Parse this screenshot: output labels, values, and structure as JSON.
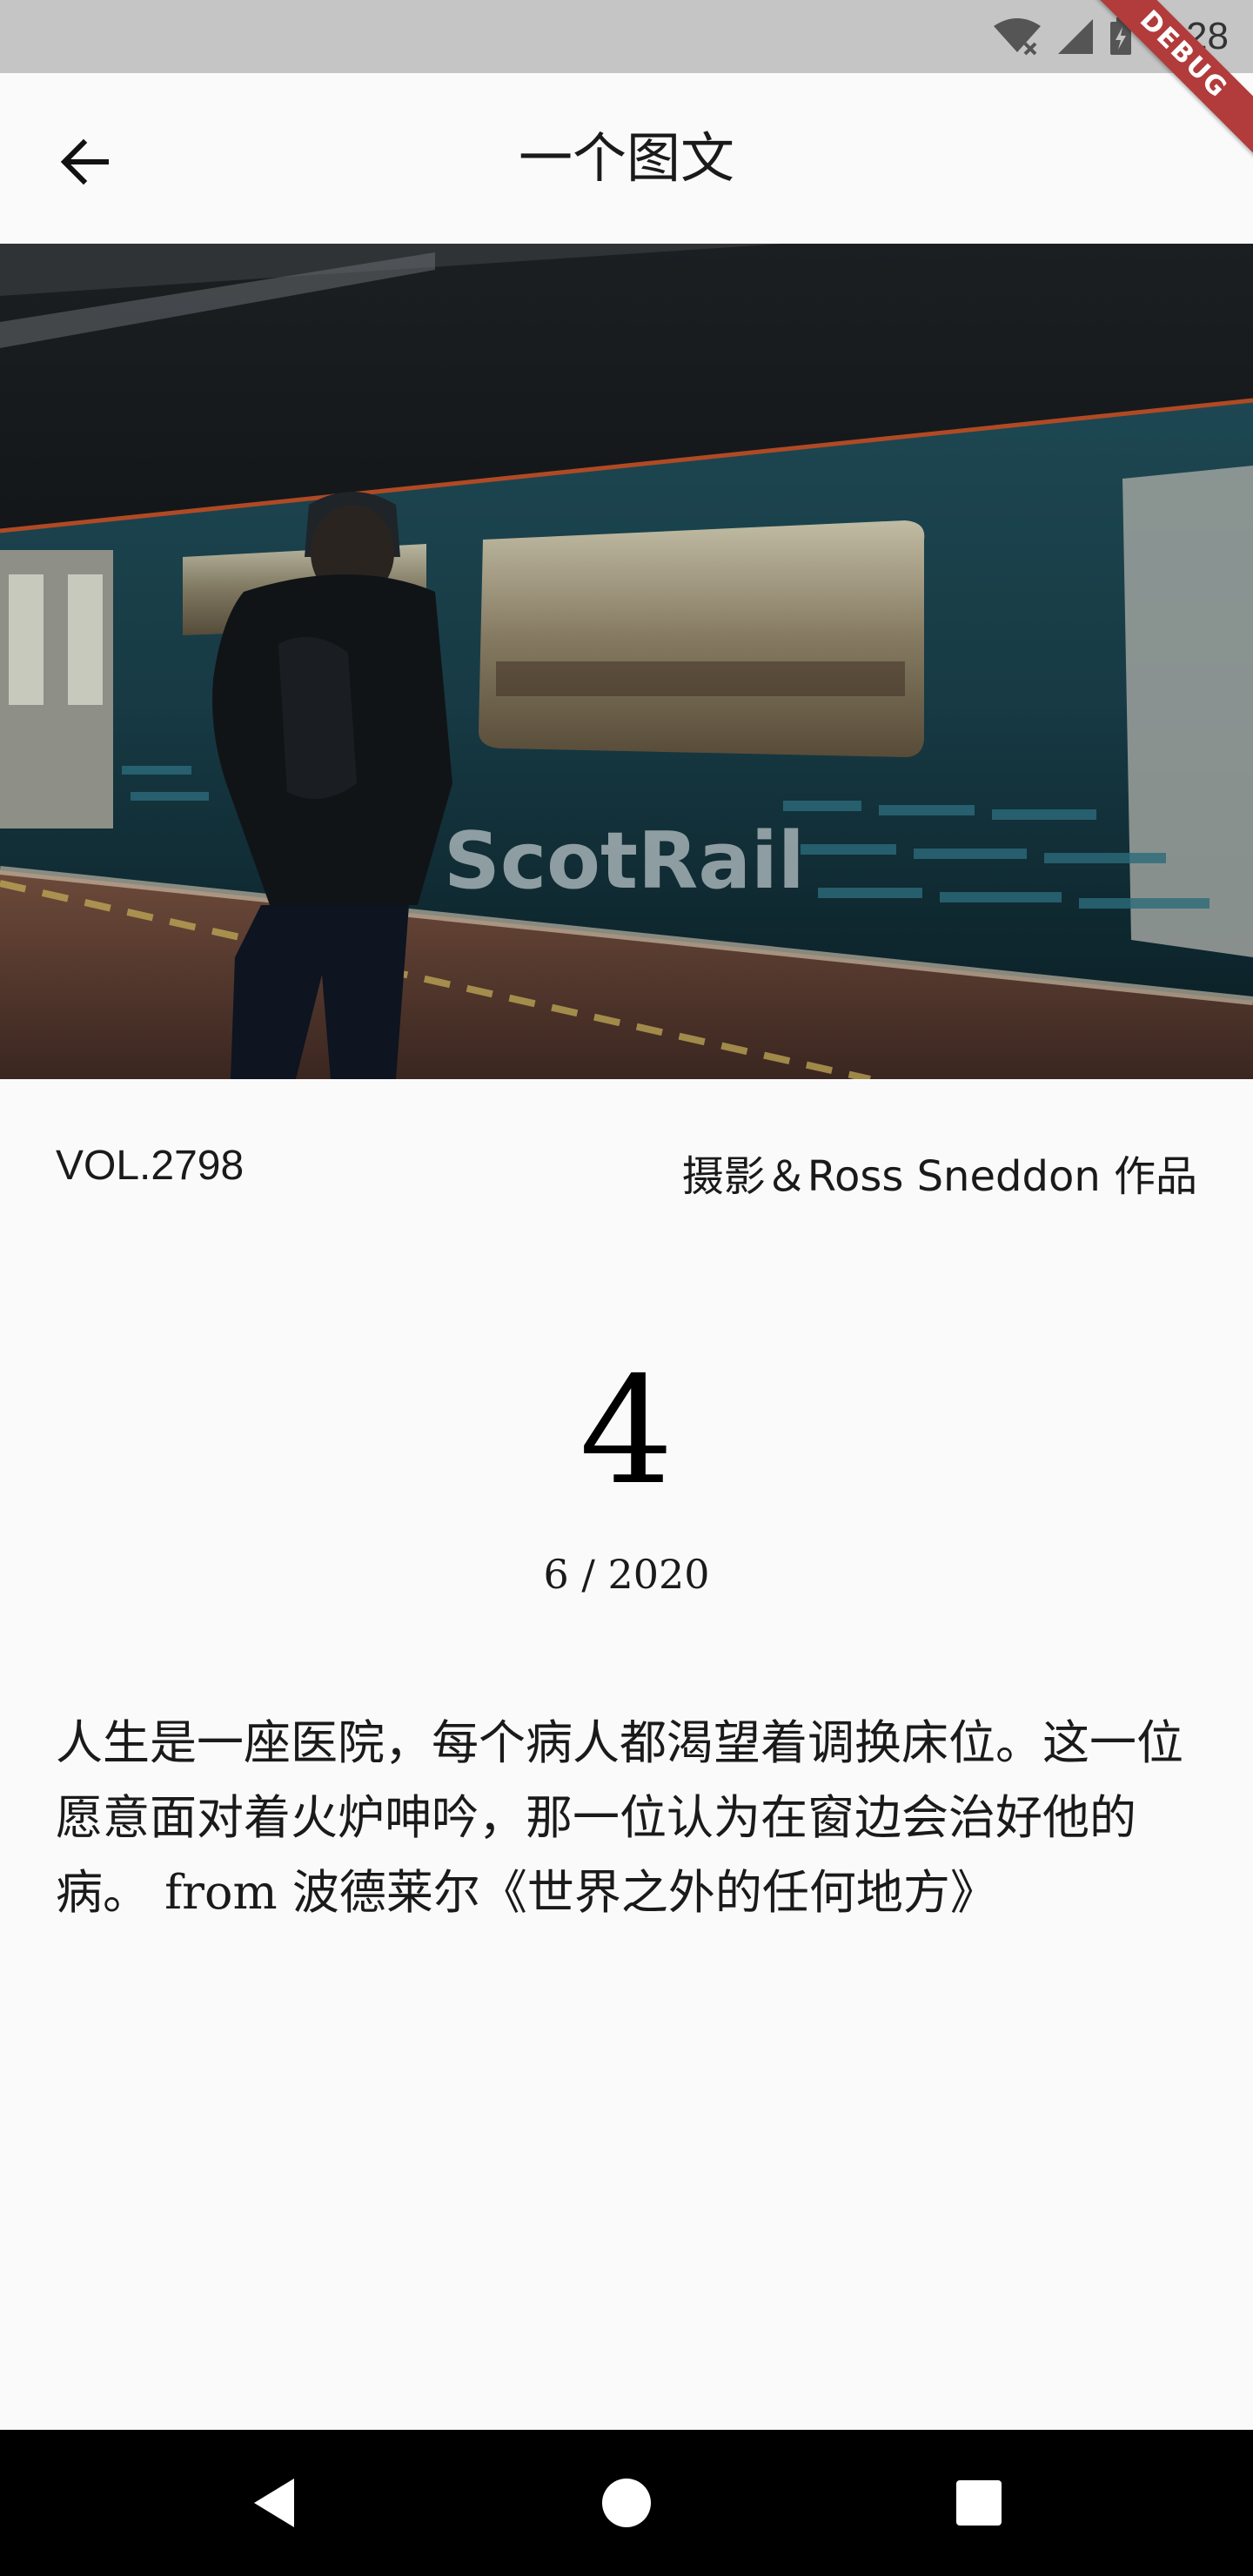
{
  "status_bar": {
    "time": "1:28",
    "icons": [
      "wifi-off-icon",
      "signal-icon",
      "battery-charging-icon"
    ]
  },
  "debug_banner": "DEBUG",
  "app_bar": {
    "title": "一个图文",
    "back_icon": "arrow-back-icon"
  },
  "meta": {
    "volume": "VOL.2798",
    "credit": "摄影＆Ross Sneddon 作品"
  },
  "date": {
    "day": "4",
    "month_year": "6 / 2020"
  },
  "quote": "人生是一座医院，每个病人都渴望着调换床位。这一位愿意面对着火炉呻吟，那一位认为在窗边会治好他的病。 from 波德莱尔《世界之外的任何地方》",
  "nav_bar": {
    "icons": [
      "nav-back-icon",
      "nav-home-icon",
      "nav-recents-icon"
    ]
  },
  "colors": {
    "status_bar": "#c5c5c5",
    "background": "#fafafa",
    "debug_ribbon": "#b23b3b",
    "nav_bar": "#000000"
  }
}
